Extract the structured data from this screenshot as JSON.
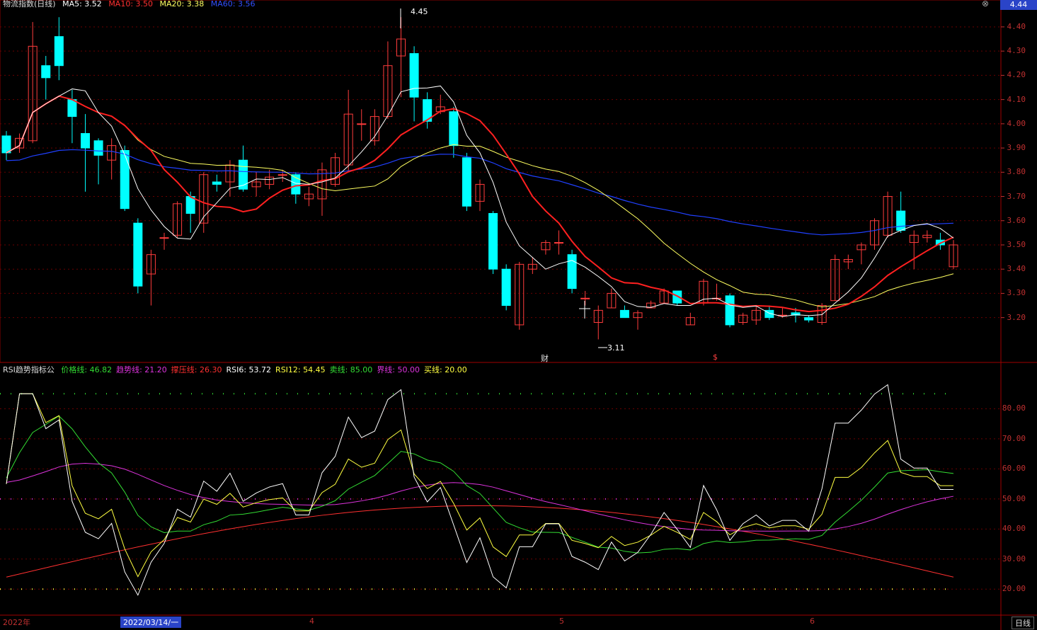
{
  "header": {
    "title": "物流指数(日线)",
    "ma_label": "MA5: 3.52",
    "ma10_label": "MA10: 3.50",
    "ma20_label": "MA20: 3.38",
    "ma60_label": "MA60: 3.56",
    "close_symbol": "⊗"
  },
  "price_axis": {
    "current_price": "4.44",
    "ticks": [
      "4.40",
      "4.30",
      "4.20",
      "4.10",
      "4.00",
      "3.90",
      "3.80",
      "3.70",
      "3.60",
      "3.50",
      "3.40",
      "3.30",
      "3.20"
    ]
  },
  "annotations": {
    "high": "4.45",
    "low": "3.11",
    "finance_mark_1": "财",
    "finance_mark_2": "$"
  },
  "indicator": {
    "name": "RSI趋势指标公",
    "items": [
      {
        "label": "价格线: 46.82",
        "color": "#33dd33"
      },
      {
        "label": "趋势线: 21.20",
        "color": "#dd33dd"
      },
      {
        "label": "撑压线: 26.30",
        "color": "#ff3030"
      },
      {
        "label": "RSI6: 53.72",
        "color": "#ffffff"
      },
      {
        "label": "RSI12: 54.45",
        "color": "#ffff40"
      },
      {
        "label": "卖线: 85.00",
        "color": "#33dd33"
      },
      {
        "label": "界线: 50.00",
        "color": "#dd33dd"
      },
      {
        "label": "买线: 20.00",
        "color": "#ffff40"
      }
    ],
    "ticks": [
      "80.00",
      "70.00",
      "60.00",
      "50.00",
      "40.00",
      "30.00",
      "20.00"
    ]
  },
  "x_axis": {
    "labels": [
      "2022年",
      "4",
      "5",
      "6"
    ],
    "cursor_date": "2022/03/14/一",
    "period": "日线"
  },
  "colors": {
    "up": "#ff3c3c",
    "down": "#00ffff",
    "ma5": "#ffffff",
    "ma10": "#ff2020",
    "ma20": "#ffff60",
    "ma60": "#2040ff"
  },
  "chart_data": {
    "type": "candlestick",
    "candles": [
      [
        3.95,
        3.88,
        3.97,
        3.85
      ],
      [
        3.9,
        3.94,
        3.96,
        3.88
      ],
      [
        3.93,
        4.32,
        4.42,
        3.92
      ],
      [
        4.24,
        4.19,
        4.28,
        4.1
      ],
      [
        4.36,
        4.24,
        4.44,
        4.18
      ],
      [
        4.1,
        4.03,
        4.14,
        3.92
      ],
      [
        3.96,
        3.9,
        4.04,
        3.72
      ],
      [
        3.93,
        3.87,
        3.94,
        3.75
      ],
      [
        3.85,
        3.91,
        3.94,
        3.77
      ],
      [
        3.89,
        3.65,
        3.91,
        3.64
      ],
      [
        3.59,
        3.33,
        3.61,
        3.3
      ],
      [
        3.38,
        3.46,
        3.48,
        3.25
      ],
      [
        3.53,
        3.53,
        3.55,
        3.48
      ],
      [
        3.54,
        3.67,
        3.68,
        3.53
      ],
      [
        3.7,
        3.63,
        3.72,
        3.55
      ],
      [
        3.59,
        3.79,
        3.8,
        3.55
      ],
      [
        3.76,
        3.75,
        3.79,
        3.72
      ],
      [
        3.76,
        3.83,
        3.85,
        3.7
      ],
      [
        3.85,
        3.73,
        3.91,
        3.72
      ],
      [
        3.74,
        3.76,
        3.8,
        3.7
      ],
      [
        3.75,
        3.78,
        3.81,
        3.73
      ],
      [
        3.79,
        3.79,
        3.81,
        3.76
      ],
      [
        3.79,
        3.71,
        3.8,
        3.67
      ],
      [
        3.69,
        3.71,
        3.74,
        3.66
      ],
      [
        3.69,
        3.81,
        3.84,
        3.62
      ],
      [
        3.75,
        3.86,
        3.88,
        3.74
      ],
      [
        3.83,
        4.04,
        4.14,
        3.8
      ],
      [
        4.0,
        4.0,
        4.06,
        3.93
      ],
      [
        3.93,
        4.03,
        4.06,
        3.91
      ],
      [
        4.03,
        4.24,
        4.34,
        4.02
      ],
      [
        4.28,
        4.35,
        4.44,
        4.11
      ],
      [
        4.29,
        4.11,
        4.32,
        4.01
      ],
      [
        4.1,
        4.01,
        4.13,
        3.98
      ],
      [
        4.05,
        4.07,
        4.12,
        4.04
      ],
      [
        4.05,
        3.91,
        4.07,
        3.86
      ],
      [
        3.86,
        3.66,
        3.88,
        3.64
      ],
      [
        3.68,
        3.75,
        3.77,
        3.64
      ],
      [
        3.63,
        3.4,
        3.64,
        3.38
      ],
      [
        3.4,
        3.25,
        3.42,
        3.23
      ],
      [
        3.17,
        3.42,
        3.43,
        3.15
      ],
      [
        3.4,
        3.42,
        3.45,
        3.38
      ],
      [
        3.48,
        3.51,
        3.52,
        3.46
      ],
      [
        3.51,
        3.51,
        3.56,
        3.46
      ],
      [
        3.46,
        3.32,
        3.48,
        3.3
      ],
      [
        3.28,
        3.28,
        3.31,
        3.25
      ],
      [
        3.18,
        3.23,
        3.25,
        3.11
      ],
      [
        3.24,
        3.3,
        3.32,
        3.24
      ],
      [
        3.23,
        3.2,
        3.25,
        3.2
      ],
      [
        3.2,
        3.22,
        3.23,
        3.15
      ],
      [
        3.24,
        3.26,
        3.27,
        3.24
      ],
      [
        3.26,
        3.31,
        3.32,
        3.26
      ],
      [
        3.31,
        3.26,
        3.31,
        3.25
      ],
      [
        3.17,
        3.2,
        3.22,
        3.17
      ],
      [
        3.26,
        3.35,
        3.36,
        3.25
      ],
      [
        3.28,
        3.28,
        3.34,
        3.27
      ],
      [
        3.29,
        3.17,
        3.3,
        3.16
      ],
      [
        3.18,
        3.21,
        3.22,
        3.17
      ],
      [
        3.19,
        3.23,
        3.25,
        3.17
      ],
      [
        3.23,
        3.2,
        3.25,
        3.19
      ],
      [
        3.21,
        3.21,
        3.24,
        3.2
      ],
      [
        3.22,
        3.21,
        3.24,
        3.18
      ],
      [
        3.2,
        3.19,
        3.21,
        3.18
      ],
      [
        3.18,
        3.25,
        3.26,
        3.17
      ],
      [
        3.27,
        3.44,
        3.46,
        3.27
      ],
      [
        3.43,
        3.44,
        3.46,
        3.4
      ],
      [
        3.48,
        3.5,
        3.51,
        3.42
      ],
      [
        3.5,
        3.6,
        3.61,
        3.48
      ],
      [
        3.54,
        3.7,
        3.72,
        3.53
      ],
      [
        3.64,
        3.56,
        3.72,
        3.55
      ],
      [
        3.51,
        3.54,
        3.56,
        3.4
      ],
      [
        3.53,
        3.54,
        3.56,
        3.51
      ],
      [
        3.52,
        3.5,
        3.55,
        3.48
      ],
      [
        3.41,
        3.5,
        3.52,
        3.4
      ]
    ],
    "ylim": [
      3.05,
      4.47
    ],
    "rsi_ylim": [
      13,
      90
    ]
  }
}
